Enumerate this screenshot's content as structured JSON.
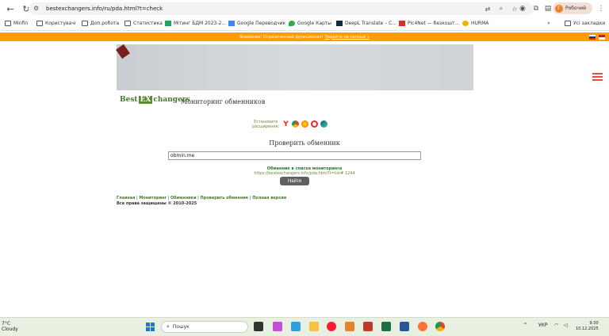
{
  "browser": {
    "url": "bestexchangers.info/ru/pda.html?t=check",
    "profile_initial": "Г",
    "profile_name": "Робочий"
  },
  "bookmarks": {
    "items": [
      {
        "label": "Minfin",
        "icon": "folder-icon"
      },
      {
        "label": "Користувачі",
        "icon": "folder-icon"
      },
      {
        "label": "Доп.робота",
        "icon": "folder-icon"
      },
      {
        "label": "Статистика",
        "icon": "folder-icon"
      },
      {
        "label": "Мітинг БДМ 2023-2...",
        "icon": "sheets-icon"
      },
      {
        "label": "Google Переводчик",
        "icon": "translate-icon"
      },
      {
        "label": "Google Карты",
        "icon": "maps-icon"
      },
      {
        "label": "DeepL Translate – С...",
        "icon": "deepl-icon"
      },
      {
        "label": "Pic4Net — безкошт...",
        "icon": "pic4net-icon"
      },
      {
        "label": "HURMA",
        "icon": "hurma-icon"
      }
    ],
    "overflow": "»",
    "all_bookmarks": "Усі закладки"
  },
  "warning": {
    "text": "Внимание! Ограниченный функционал!",
    "link": "Перейти на полный »"
  },
  "site": {
    "logo_prefix": "Best",
    "logo_mark": "EX",
    "logo_suffix": "changers",
    "title": "Мониторинг обменников",
    "install_line1": "Установите",
    "install_line2": "расширение:",
    "check_title": "Проверить обменник",
    "search_value": "obmin.me",
    "found_label": "Обменник в списке мониторинга",
    "found_url": "https://bestexchangers.info/pda.html?t=list# 1244",
    "find_button": "Найти",
    "footer": {
      "links": [
        "Главная",
        "Мониторинг",
        "Обменники",
        "Проверить обменник",
        "Полная версия"
      ],
      "copyright": "Все права защищены © 2010-2025"
    }
  },
  "taskbar": {
    "weather_temp": "7°C",
    "weather_desc": "Cloudy",
    "search_placeholder": "Пошук",
    "lang": "УКР",
    "time": "9:30",
    "date": "10.12.2025"
  },
  "colors": {
    "warning_bar": "#ff9d00",
    "logo_green": "#5b8b34",
    "hamburger": "#e84c3d",
    "button_gray": "#606060"
  }
}
